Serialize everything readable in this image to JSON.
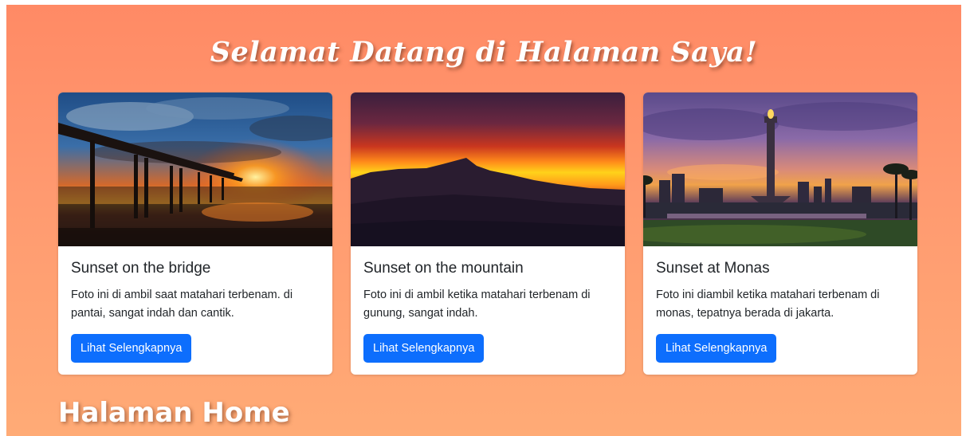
{
  "page": {
    "title": "Selamat Datang di Halaman Saya!",
    "home_heading": "Halaman Home"
  },
  "cards": [
    {
      "title": "Sunset on the bridge",
      "text": "Foto ini di ambil saat matahari terbenam. di pantai, sangat indah dan cantik.",
      "button": "Lihat Selengkapnya",
      "image": "sunset-bridge-photo"
    },
    {
      "title": "Sunset on the mountain",
      "text": "Foto ini di ambil ketika matahari terbenam di gunung, sangat indah.",
      "button": "Lihat Selengkapnya",
      "image": "sunset-mountain-photo"
    },
    {
      "title": "Sunset at Monas",
      "text": "Foto ini diambil ketika matahari terbenam di monas, tepatnya berada di jakarta.",
      "button": "Lihat Selengkapnya",
      "image": "sunset-monas-photo"
    }
  ],
  "colors": {
    "background_top": "#ff8a65",
    "background_bottom": "#ffab76",
    "button": "#0d6efd",
    "card": "#ffffff"
  }
}
